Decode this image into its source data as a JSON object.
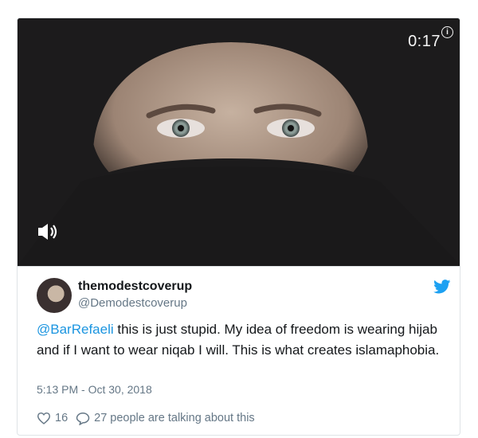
{
  "video": {
    "duration": "0:17",
    "info_glyph": "i",
    "sound_icon": "speaker-muted-icon"
  },
  "tweet": {
    "display_name": "themodestcoverup",
    "handle": "@Demodestcoverup",
    "mention": "@BarRefaeli",
    "text": " this is just stupid. My idea of freedom is wearing hijab and if I want to wear niqab I will.  This is what creates islamaphobia.",
    "timestamp": "5:13 PM - Oct 30, 2018",
    "likes": "16",
    "conversation": "27 people are talking about this"
  },
  "colors": {
    "link": "#1b95e0",
    "muted": "#657786",
    "text": "#14171a",
    "twitter_blue": "#1da1f2"
  }
}
